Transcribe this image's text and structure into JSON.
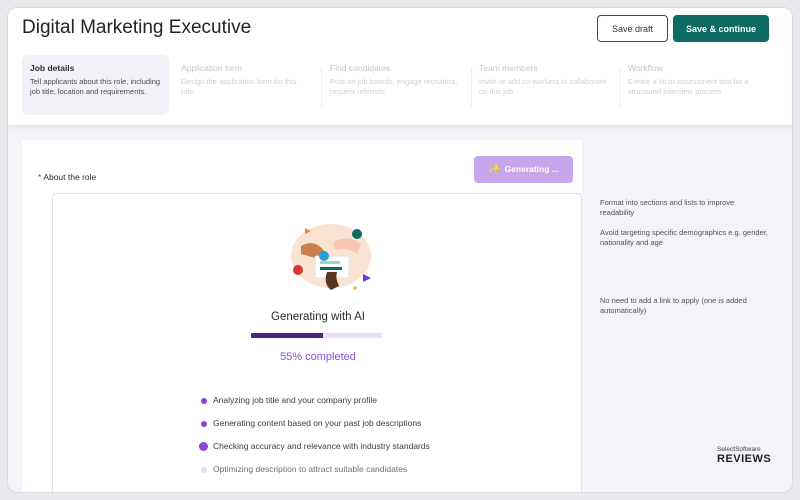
{
  "header": {
    "title": "Digital Marketing Executive",
    "save_draft_label": "Save draft",
    "save_continue_label": "Save & continue"
  },
  "steps": [
    {
      "title": "Job details",
      "desc": "Tell applicants about this role, including job title, location and requirements.",
      "active": true
    },
    {
      "title": "Application form",
      "desc": "Design the application form for this role.",
      "active": false
    },
    {
      "title": "Find candidates",
      "desc": "Post on job boards, engage recruiters, request referrals.",
      "active": false
    },
    {
      "title": "Team members",
      "desc": "Invite or add co-workers to collaborate on this job.",
      "active": false
    },
    {
      "title": "Workflow",
      "desc": "Create a kit or assessment test for a structured interview process.",
      "active": false
    }
  ],
  "about": {
    "required_mark": "*",
    "label": "About the role",
    "generate_button_label": "Generating ..."
  },
  "generation": {
    "title": "Generating with AI",
    "progress": 0.55,
    "percent_label": "55% completed",
    "tasks": [
      {
        "label": "Analyzing job title and your company profile",
        "state": "done"
      },
      {
        "label": "Generating content based on your past job descriptions",
        "state": "done"
      },
      {
        "label": "Checking accuracy and relevance with industry standards",
        "state": "active"
      },
      {
        "label": "Optimizing description to attract suitable candidates",
        "state": "pending"
      }
    ]
  },
  "tips": [
    "Format into sections and lists to improve readability",
    "Avoid targeting specific demographics e.g. gender, nationality and age",
    "No need to add a link to apply (one is added automatically)"
  ],
  "watermark": {
    "line1": "SelectSoftware",
    "line2": "REVIEWS"
  },
  "colors": {
    "accent": "#0d6b64",
    "purple": "#8a47d9",
    "progress_dark": "#4b2483"
  }
}
